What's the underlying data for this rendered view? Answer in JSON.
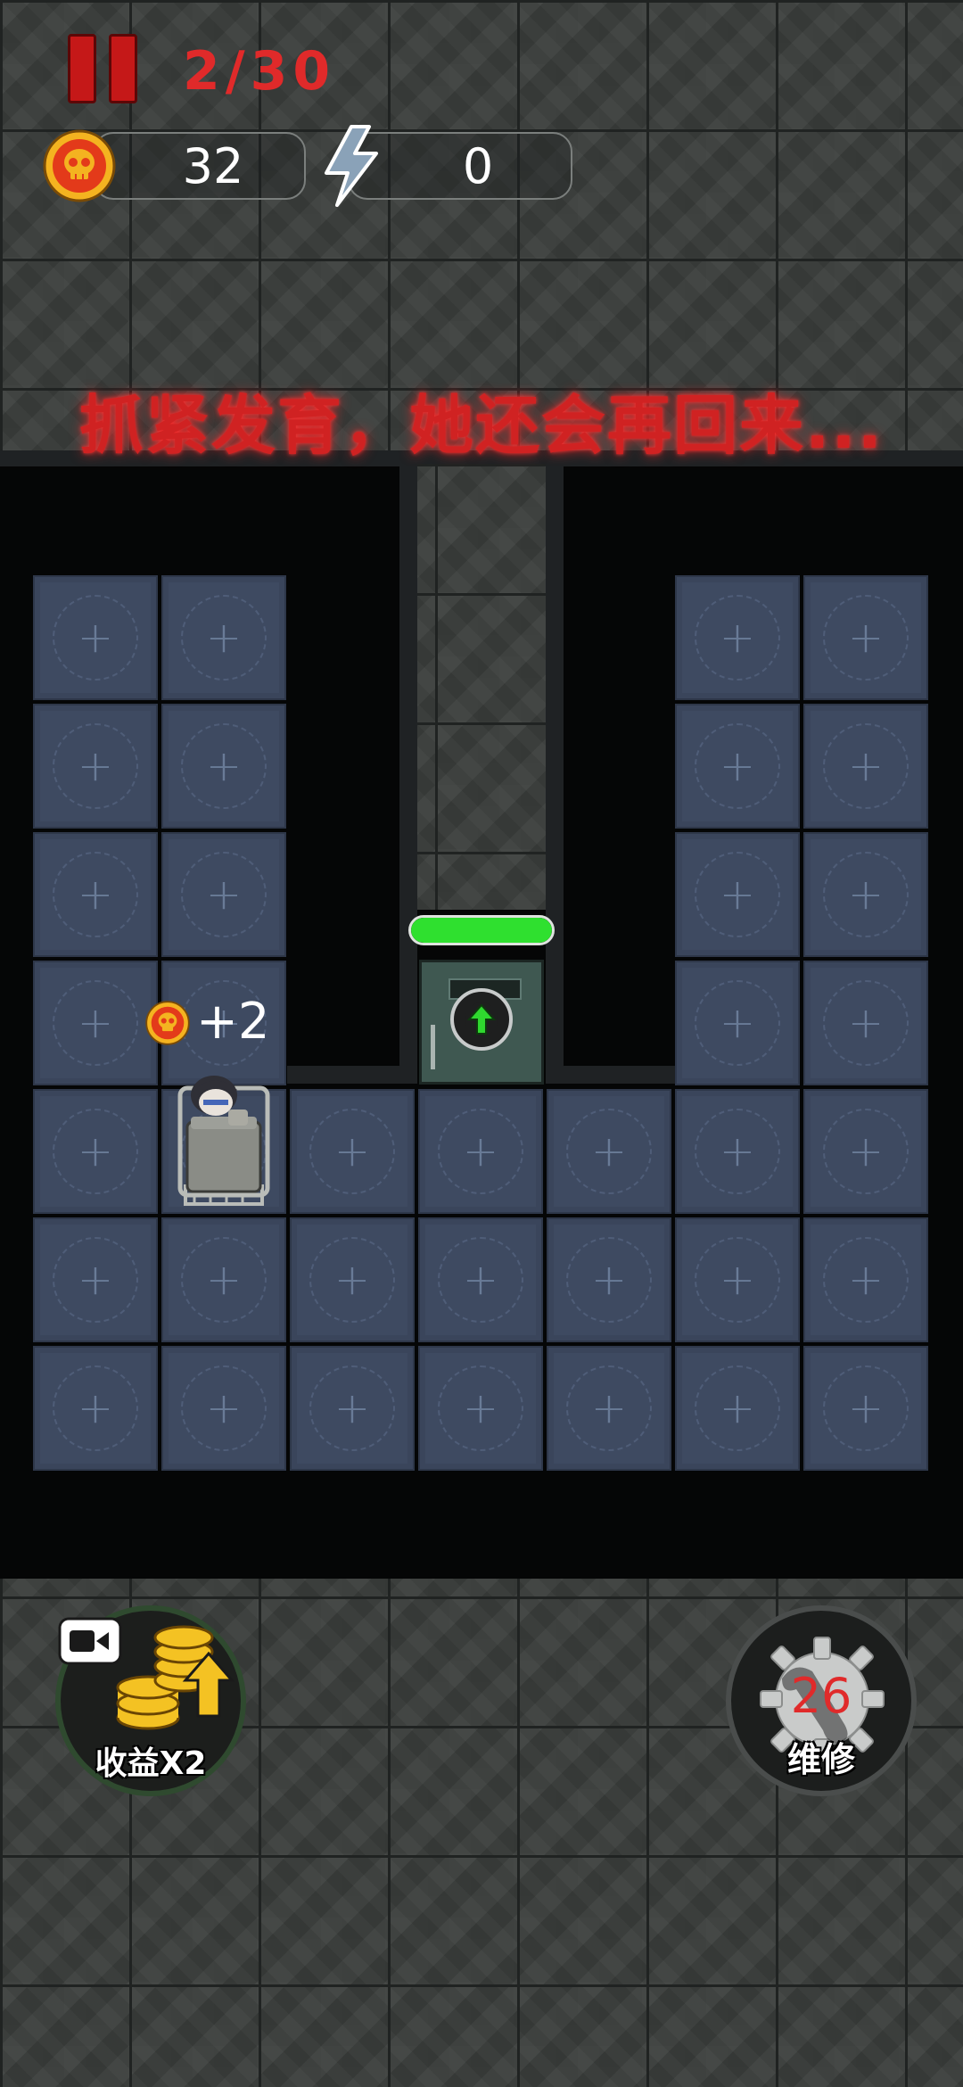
{
  "hud": {
    "wave": "2/30",
    "coins": "32",
    "energy": "0"
  },
  "warning": "抓紧发育，她还会再回来...",
  "reward": {
    "amount": "+2"
  },
  "door": {
    "health_fraction": 1.0
  },
  "buttons": {
    "income_x2": "收益X2",
    "repair_cost": "26",
    "repair": "维修"
  },
  "colors": {
    "warning_red": "#d02222",
    "health_green": "#2fe02f",
    "tile_blue": "#3e4a61"
  }
}
